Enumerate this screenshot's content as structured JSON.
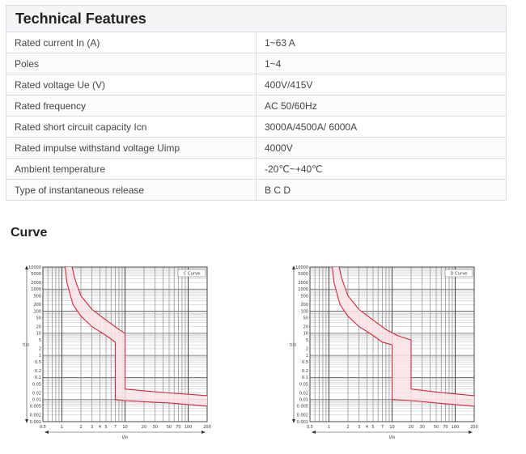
{
  "spec": {
    "title": "Technical Features",
    "rows": [
      {
        "label": "Rated current In (A)",
        "value": "1~63 A"
      },
      {
        "label": "Poles",
        "value": "1~4"
      },
      {
        "label": "Rated voltage Ue (V)",
        "value": "400V/415V"
      },
      {
        "label": "Rated frequency",
        "value": "AC 50/60Hz"
      },
      {
        "label": "Rated short circuit capacity Icn",
        "value": "3000A/4500A/ 6000A"
      },
      {
        "label": "Rated impulse withstand voltage Uimp",
        "value": "4000V"
      },
      {
        "label": "Ambient temperature",
        "value": "-20℃~+40℃"
      },
      {
        "label": "Type of instantaneous release",
        "value": "B C D"
      }
    ]
  },
  "curve": {
    "heading": "Curve"
  },
  "chart_data": [
    {
      "type": "line",
      "title": "",
      "legend": "C Curve",
      "xlabel": "I/In",
      "ylabel": "t(s)",
      "xscale": "log",
      "yscale": "log",
      "xlim": [
        0.5,
        200
      ],
      "ylim": [
        0.001,
        10000
      ],
      "grid": true,
      "color": "#d0283c",
      "x_ticks": [
        "0.5",
        "1",
        "2",
        "3",
        "4",
        "5",
        "7",
        "10",
        "20",
        "30",
        "50",
        "70",
        "100",
        "200"
      ],
      "y_ticks": [
        "10000",
        "5000",
        "2000",
        "1000",
        "500",
        "200",
        "100",
        "50",
        "20",
        "10",
        "5",
        "2",
        "1",
        "0.5",
        "0.2",
        "0.1",
        "0.05",
        "0.02",
        "0.01",
        "0.005",
        "0.002",
        "0.001"
      ],
      "series": [
        {
          "x": [
            1.13,
            1.2,
            1.5,
            2,
            3,
            5,
            7
          ],
          "y": [
            10000,
            2000,
            200,
            60,
            20,
            8,
            4
          ]
        },
        {
          "x": [
            1.45,
            1.6,
            2,
            3,
            5,
            8,
            10,
            10,
            20,
            50,
            200
          ],
          "y": [
            10000,
            3000,
            500,
            120,
            40,
            15,
            10,
            0.03,
            0.025,
            0.02,
            0.015
          ]
        },
        {
          "x": [
            7,
            7,
            10,
            20,
            50,
            200
          ],
          "y": [
            4,
            0.01,
            0.009,
            0.008,
            0.007,
            0.005
          ]
        }
      ]
    },
    {
      "type": "line",
      "title": "",
      "legend": "D Curve",
      "xlabel": "I/In",
      "ylabel": "t(s)",
      "xscale": "log",
      "yscale": "log",
      "xlim": [
        0.5,
        200
      ],
      "ylim": [
        0.001,
        10000
      ],
      "grid": true,
      "color": "#d0283c",
      "x_ticks": [
        "0.5",
        "1",
        "2",
        "3",
        "4",
        "5",
        "7",
        "10",
        "20",
        "30",
        "50",
        "70",
        "100",
        "200"
      ],
      "y_ticks": [
        "10000",
        "5000",
        "2000",
        "1000",
        "500",
        "200",
        "100",
        "50",
        "20",
        "10",
        "5",
        "2",
        "1",
        "0.5",
        "0.2",
        "0.1",
        "0.05",
        "0.02",
        "0.01",
        "0.005",
        "0.002",
        "0.001"
      ],
      "series": [
        {
          "x": [
            1.13,
            1.2,
            1.5,
            2,
            3,
            5,
            7,
            10
          ],
          "y": [
            10000,
            2000,
            200,
            60,
            20,
            8,
            4,
            3
          ]
        },
        {
          "x": [
            1.45,
            1.6,
            2,
            3,
            5,
            8,
            12,
            20,
            20,
            50,
            200
          ],
          "y": [
            10000,
            3000,
            500,
            120,
            40,
            15,
            8,
            5,
            0.03,
            0.022,
            0.015
          ]
        },
        {
          "x": [
            10,
            10,
            20,
            50,
            200
          ],
          "y": [
            3,
            0.01,
            0.009,
            0.007,
            0.005
          ]
        }
      ]
    }
  ]
}
